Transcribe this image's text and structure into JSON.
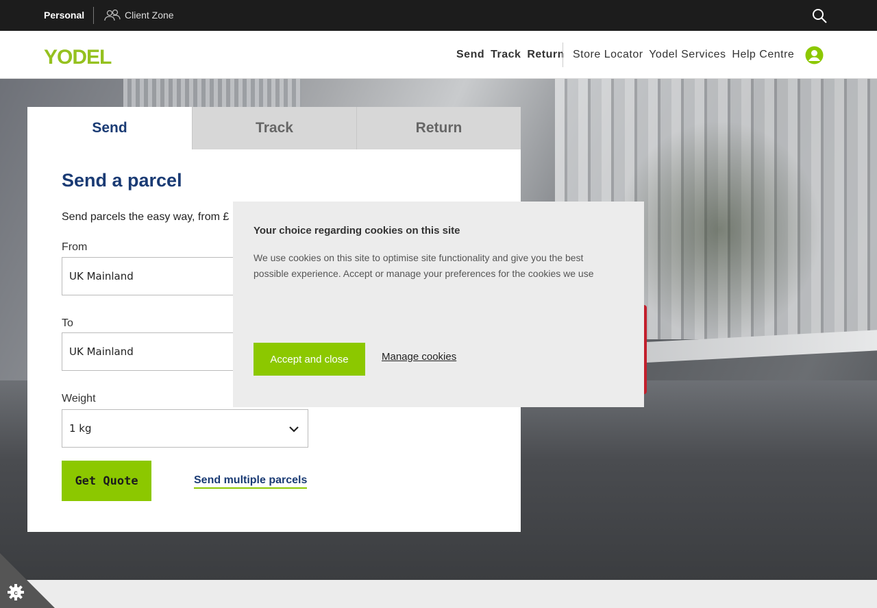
{
  "topbar": {
    "personal_label": "Personal",
    "client_zone_label": "Client Zone",
    "icons": {
      "client": "users-icon",
      "search": "search-icon"
    }
  },
  "header": {
    "logo_text": "YODEL",
    "primary_nav": [
      "Send",
      "Track",
      "Return"
    ],
    "secondary_nav": [
      "Store Locator",
      "Yodel Services",
      "Help Centre"
    ],
    "icons": {
      "account": "user-circle-icon"
    }
  },
  "form": {
    "tabs": [
      "Send",
      "Track",
      "Return"
    ],
    "active_tab": "Send",
    "title": "Send a parcel",
    "intro": "Send parcels the easy way, from £",
    "from_label": "From",
    "from_value": "UK Mainland",
    "to_label": "To",
    "to_value": "UK Mainland",
    "weight_label": "Weight",
    "weight_value": "1 kg",
    "get_quote_label": "Get Quote",
    "multiple_label": "Send multiple parcels"
  },
  "cookie_banner": {
    "title": "Your choice regarding cookies on this site",
    "body": "We use cookies on this site to optimise site functionality and give you the best possible experience. Accept or manage your preferences for the cookies we use",
    "accept_label": "Accept and close",
    "manage_label": "Manage cookies"
  },
  "colors": {
    "brand_green": "#8cc800",
    "brand_navy": "#1a3b74",
    "topbar_bg": "#1c1c1c"
  }
}
